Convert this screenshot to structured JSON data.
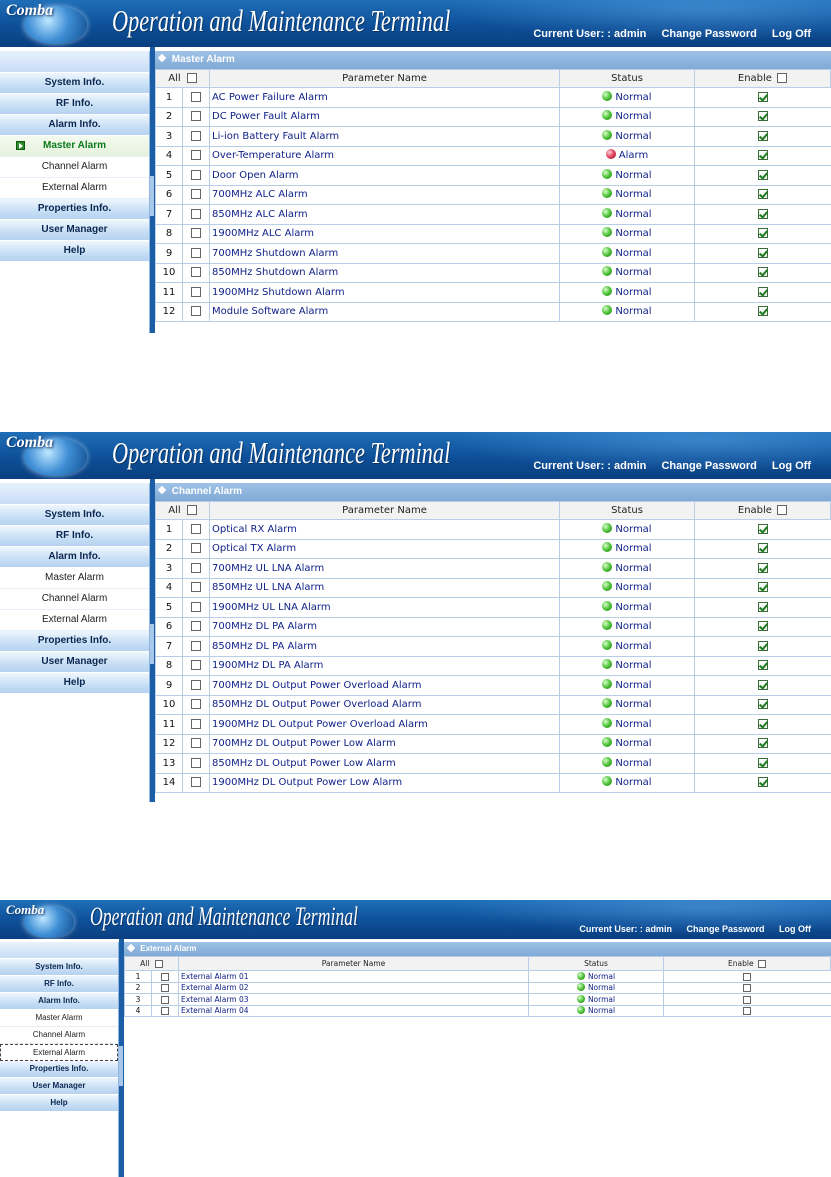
{
  "header": {
    "brand": "Comba",
    "title": "Operation and Maintenance Terminal",
    "current_user": "Current User: : admin",
    "change_password": "Change Password",
    "log_off": "Log Off"
  },
  "menu": {
    "system_info": "System Info.",
    "rf_info": "RF Info.",
    "alarm_info": "Alarm Info.",
    "master_alarm": "Master Alarm",
    "channel_alarm": "Channel Alarm",
    "external_alarm": "External Alarm",
    "properties_info": "Properties Info.",
    "user_manager": "User Manager",
    "help": "Help"
  },
  "table_headers": {
    "all": "All",
    "parameter_name": "Parameter Name",
    "status": "Status",
    "enable": "Enable"
  },
  "screens": [
    {
      "section_title": "Master Alarm",
      "active_menu": "master_alarm",
      "rows": [
        {
          "num": "1",
          "name": "AC Power Failure Alarm",
          "status": "Normal",
          "led": "green",
          "enabled": true
        },
        {
          "num": "2",
          "name": "DC Power Fault Alarm",
          "status": "Normal",
          "led": "green",
          "enabled": true
        },
        {
          "num": "3",
          "name": "Li-ion Battery Fault Alarm",
          "status": "Normal",
          "led": "green",
          "enabled": true
        },
        {
          "num": "4",
          "name": "Over-Temperature Alarm",
          "status": "Alarm",
          "led": "red",
          "enabled": true
        },
        {
          "num": "5",
          "name": "Door Open Alarm",
          "status": "Normal",
          "led": "green",
          "enabled": true
        },
        {
          "num": "6",
          "name": "700MHz ALC Alarm",
          "status": "Normal",
          "led": "green",
          "enabled": true
        },
        {
          "num": "7",
          "name": "850MHz ALC Alarm",
          "status": "Normal",
          "led": "green",
          "enabled": true
        },
        {
          "num": "8",
          "name": "1900MHz ALC Alarm",
          "status": "Normal",
          "led": "green",
          "enabled": true
        },
        {
          "num": "9",
          "name": "700MHz Shutdown Alarm",
          "status": "Normal",
          "led": "green",
          "enabled": true
        },
        {
          "num": "10",
          "name": "850MHz Shutdown Alarm",
          "status": "Normal",
          "led": "green",
          "enabled": true
        },
        {
          "num": "11",
          "name": "1900MHz Shutdown Alarm",
          "status": "Normal",
          "led": "green",
          "enabled": true
        },
        {
          "num": "12",
          "name": "Module Software Alarm",
          "status": "Normal",
          "led": "green",
          "enabled": true
        }
      ]
    },
    {
      "section_title": "Channel Alarm",
      "active_menu": "",
      "rows": [
        {
          "num": "1",
          "name": "Optical RX Alarm",
          "status": "Normal",
          "led": "green",
          "enabled": true
        },
        {
          "num": "2",
          "name": "Optical TX Alarm",
          "status": "Normal",
          "led": "green",
          "enabled": true
        },
        {
          "num": "3",
          "name": "700MHz UL LNA Alarm",
          "status": "Normal",
          "led": "green",
          "enabled": true
        },
        {
          "num": "4",
          "name": "850MHz UL LNA Alarm",
          "status": "Normal",
          "led": "green",
          "enabled": true
        },
        {
          "num": "5",
          "name": "1900MHz UL LNA Alarm",
          "status": "Normal",
          "led": "green",
          "enabled": true
        },
        {
          "num": "6",
          "name": "700MHz DL PA Alarm",
          "status": "Normal",
          "led": "green",
          "enabled": true
        },
        {
          "num": "7",
          "name": "850MHz DL PA Alarm",
          "status": "Normal",
          "led": "green",
          "enabled": true
        },
        {
          "num": "8",
          "name": "1900MHz DL PA Alarm",
          "status": "Normal",
          "led": "green",
          "enabled": true
        },
        {
          "num": "9",
          "name": "700MHz DL Output Power Overload Alarm",
          "status": "Normal",
          "led": "green",
          "enabled": true
        },
        {
          "num": "10",
          "name": "850MHz DL Output Power Overload Alarm",
          "status": "Normal",
          "led": "green",
          "enabled": true
        },
        {
          "num": "11",
          "name": "1900MHz DL Output Power Overload Alarm",
          "status": "Normal",
          "led": "green",
          "enabled": true
        },
        {
          "num": "12",
          "name": "700MHz DL Output Power Low Alarm",
          "status": "Normal",
          "led": "green",
          "enabled": true
        },
        {
          "num": "13",
          "name": "850MHz DL Output Power Low Alarm",
          "status": "Normal",
          "led": "green",
          "enabled": true
        },
        {
          "num": "14",
          "name": "1900MHz DL Output Power Low Alarm",
          "status": "Normal",
          "led": "green",
          "enabled": true
        }
      ]
    },
    {
      "section_title": "External Alarm",
      "active_menu": "external_alarm",
      "rows": [
        {
          "num": "1",
          "name": "External Alarm 01",
          "status": "Normal",
          "led": "green",
          "enabled": false
        },
        {
          "num": "2",
          "name": "External Alarm 02",
          "status": "Normal",
          "led": "green",
          "enabled": false
        },
        {
          "num": "3",
          "name": "External Alarm 03",
          "status": "Normal",
          "led": "green",
          "enabled": false
        },
        {
          "num": "4",
          "name": "External Alarm 04",
          "status": "Normal",
          "led": "green",
          "enabled": false
        }
      ]
    }
  ],
  "colors": {
    "header_blue": "#0d4f98",
    "menu_blue": "#c7def5",
    "active_green": "#0a7a1a",
    "status_normal": "#4fc23a",
    "status_alarm": "#e0405a"
  }
}
